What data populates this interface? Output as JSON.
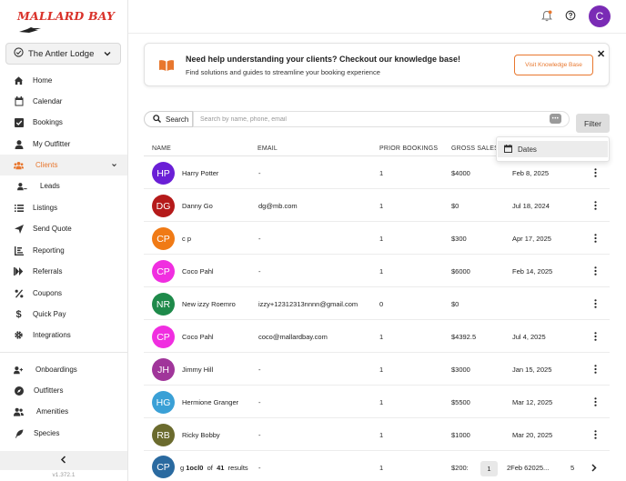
{
  "brand": {
    "logo_text": "MALLARD BAY",
    "accent": "#e8772e",
    "logo_color": "#d9322a"
  },
  "sidebar": {
    "outfitter": {
      "name": "The Antler Lodge",
      "icon": "checkmark-badge-icon"
    },
    "items": [
      {
        "label": "Home",
        "icon": "home-icon"
      },
      {
        "label": "Calendar",
        "icon": "calendar-icon"
      },
      {
        "label": "Bookings",
        "icon": "checkbox-icon"
      },
      {
        "label": "My Outfitter",
        "icon": "person-icon"
      },
      {
        "label": "Clients",
        "icon": "people-icon",
        "active": true
      },
      {
        "label": "Leads",
        "icon": "person-lines-icon"
      },
      {
        "label": "Listings",
        "icon": "list-icon"
      },
      {
        "label": "Send Quote",
        "icon": "paper-plane-icon"
      },
      {
        "label": "Reporting",
        "icon": "report-icon"
      },
      {
        "label": "Referrals",
        "icon": "fast-forward-icon"
      },
      {
        "label": "Coupons",
        "icon": "percent-icon"
      },
      {
        "label": "Quick Pay",
        "icon": "dollar-icon"
      },
      {
        "label": "Integrations",
        "icon": "gear-icon"
      }
    ],
    "items2": [
      {
        "label": "Onboardings",
        "icon": "person-add-icon"
      },
      {
        "label": "Outfitters",
        "icon": "compass-icon"
      },
      {
        "label": "Amenities",
        "icon": "people-icon"
      },
      {
        "label": "Species",
        "icon": "feather-icon"
      }
    ],
    "version": "v1.372.1"
  },
  "topbar": {
    "avatar_initial": "C",
    "avatar_color": "#7a2bb5"
  },
  "banner": {
    "title": "Need help understanding your clients? Checkout our knowledge base!",
    "description": "Find solutions and guides to streamline your booking experience",
    "button_label": "Visit Knowledge Base",
    "close_label": "✕"
  },
  "search": {
    "button_label": "Search",
    "placeholder": "Search by name, phone, email"
  },
  "filter": {
    "button_label": "Filter",
    "dropdown_option": "Dates"
  },
  "table": {
    "headers": {
      "name": "NAME",
      "email": "EMAIL",
      "prior_bookings": "PRIOR BOOKINGS",
      "gross_sales": "GROSS SALES"
    },
    "rows": [
      {
        "initials": "HP",
        "color": "#6a1fd6",
        "name": "Harry Potter",
        "email": "-",
        "bookings": "1",
        "sales": "$4000",
        "date": "Feb 8, 2025"
      },
      {
        "initials": "DG",
        "color": "#b51a1a",
        "name": "Danny Go",
        "email": "dg@mb.com",
        "bookings": "1",
        "sales": "$0",
        "date": "Jul 18, 2024"
      },
      {
        "initials": "CP",
        "color": "#f07a15",
        "name": "c p",
        "email": "-",
        "bookings": "1",
        "sales": "$300",
        "date": "Apr 17, 2025"
      },
      {
        "initials": "CP",
        "color": "#f02ee0",
        "name": "Coco Pahl",
        "email": "-",
        "bookings": "1",
        "sales": "$6000",
        "date": "Feb 14, 2025"
      },
      {
        "initials": "NR",
        "color": "#1e8a4a",
        "name": "New izzy Roemro",
        "email": "izzy+12312313nnnn@gmail.com",
        "bookings": "0",
        "sales": "$0",
        "date": ""
      },
      {
        "initials": "CP",
        "color": "#f02ee0",
        "name": "Coco Pahl",
        "email": "coco@mallardbay.com",
        "bookings": "1",
        "sales": "$4392.5",
        "date": "Jul 4, 2025"
      },
      {
        "initials": "JH",
        "color": "#a0359a",
        "name": "Jimmy Hill",
        "email": "-",
        "bookings": "1",
        "sales": "$3000",
        "date": "Jan 15, 2025"
      },
      {
        "initials": "HG",
        "color": "#3aa0d6",
        "name": "Hermione Granger",
        "email": "-",
        "bookings": "1",
        "sales": "$5500",
        "date": "Mar 12, 2025"
      },
      {
        "initials": "RB",
        "color": "#6b6b2e",
        "name": "Ricky Bobby",
        "email": "-",
        "bookings": "1",
        "sales": "$1000",
        "date": "Mar 20, 2025"
      },
      {
        "initials": "CP",
        "color": "#2a6aa0",
        "name": "",
        "email": "-",
        "bookings": "1",
        "sales": "$200:",
        "date": "2Feb 62025..."
      }
    ]
  },
  "pagination": {
    "text_prefix": "g ",
    "range": "1ocl0",
    "of": "of",
    "total": "41",
    "suffix": "results",
    "current_page": "1",
    "last_page": "5",
    "next_icon": "chevron-right-icon"
  }
}
